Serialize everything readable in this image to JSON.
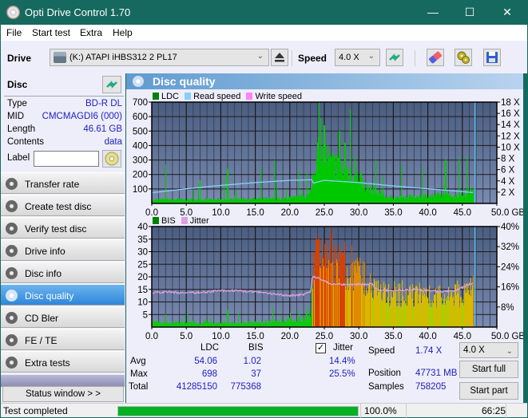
{
  "window": {
    "title": "Opti Drive Control 1.70",
    "controls": {
      "minimize": "—",
      "maximize": "☐",
      "close": "✕"
    }
  },
  "menu": [
    "File",
    "Start test",
    "Extra",
    "Help"
  ],
  "toolbar": {
    "drive_label": "Drive",
    "drive_value": "(K:)  ATAPI iHBS312  2 PL17",
    "speed_label": "Speed",
    "speed_value": "4.0 X",
    "icons": [
      "eject-icon",
      "refresh-icon",
      "erase-icon",
      "settings-icon",
      "save-icon"
    ]
  },
  "disc": {
    "heading": "Disc",
    "rows": [
      {
        "key": "Type",
        "value": "BD-R DL"
      },
      {
        "key": "MID",
        "value": "CMCMAGDI6 (000)"
      },
      {
        "key": "Length",
        "value": "46.61 GB"
      },
      {
        "key": "Contents",
        "value": "data"
      }
    ],
    "label_key": "Label",
    "label_value": ""
  },
  "nav": {
    "items": [
      {
        "label": "Transfer rate",
        "active": false
      },
      {
        "label": "Create test disc",
        "active": false
      },
      {
        "label": "Verify test disc",
        "active": false
      },
      {
        "label": "Drive info",
        "active": false
      },
      {
        "label": "Disc info",
        "active": false
      },
      {
        "label": "Disc quality",
        "active": true
      },
      {
        "label": "CD Bler",
        "active": false
      },
      {
        "label": "FE / TE",
        "active": false
      },
      {
        "label": "Extra tests",
        "active": false
      }
    ],
    "status_window_label": "Status window > >"
  },
  "main": {
    "title": "Disc quality"
  },
  "chart_data": [
    {
      "type": "bar",
      "title": "LDC / Read speed",
      "legend": [
        {
          "name": "LDC",
          "color": "#008000"
        },
        {
          "name": "Read speed",
          "color": "#87cefa"
        },
        {
          "name": "Write speed",
          "color": "#ff80ff"
        }
      ],
      "legend_position": "top-left",
      "xlabel": "GB",
      "xlim": [
        0,
        50
      ],
      "x_ticks": [
        "0.0",
        "5.0",
        "10.0",
        "15.0",
        "20.0",
        "25.0",
        "30.0",
        "35.0",
        "40.0",
        "45.0",
        "50.0 GB"
      ],
      "ylim": [
        0,
        700
      ],
      "y_ticks": [
        "100",
        "200",
        "300",
        "400",
        "500",
        "600",
        "700"
      ],
      "y2lim": [
        0,
        18
      ],
      "y2_ticks": [
        "2 X",
        "4 X",
        "6 X",
        "8 X",
        "10 X",
        "12 X",
        "14 X",
        "16 X",
        "18 X"
      ],
      "grid": true,
      "disc_end_gb": 46.61,
      "series": [
        {
          "name": "LDC",
          "color": "#00c800",
          "x": [
            0,
            2,
            4,
            6,
            8,
            10,
            12,
            14,
            16,
            18,
            20,
            21,
            22,
            23,
            23.5,
            24,
            24.5,
            25,
            25.5,
            26,
            27,
            28,
            29,
            30,
            31,
            32,
            33,
            34,
            36,
            38,
            40,
            42,
            44,
            45,
            46,
            46.5
          ],
          "values": [
            25,
            30,
            30,
            28,
            30,
            30,
            32,
            35,
            35,
            38,
            40,
            45,
            55,
            80,
            250,
            420,
            500,
            380,
            350,
            310,
            280,
            260,
            240,
            220,
            130,
            110,
            90,
            50,
            45,
            55,
            60,
            60,
            60,
            70,
            90,
            110
          ]
        },
        {
          "name": "LDC peaks",
          "x": [
            2,
            7,
            10.5,
            11,
            15.8,
            17.8,
            21.2,
            22.5,
            25,
            27.2,
            28,
            28.8,
            29.5,
            32.5,
            39.2,
            42.5,
            44.5,
            45.7
          ],
          "values": [
            270,
            160,
            165,
            240,
            250,
            300,
            230,
            220,
            540,
            500,
            420,
            650,
            330,
            300,
            240,
            300,
            320,
            320
          ]
        },
        {
          "name": "Read speed",
          "color": "#87cefa",
          "x": [
            0,
            5,
            10,
            15,
            20,
            23.2,
            23.4,
            25,
            30,
            35,
            40,
            45,
            46.61
          ],
          "values": [
            1.9,
            2.6,
            3.2,
            3.7,
            4.1,
            4.2,
            3.6,
            4.1,
            3.7,
            3.1,
            2.6,
            2.1,
            1.9
          ]
        }
      ]
    },
    {
      "type": "bar",
      "title": "BIS / Jitter",
      "legend": [
        {
          "name": "BIS",
          "color": "#008000"
        },
        {
          "name": "Jitter",
          "color": "#dda0dd"
        }
      ],
      "legend_position": "top-left",
      "xlabel": "GB",
      "xlim": [
        0,
        50
      ],
      "x_ticks": [
        "0.0",
        "5.0",
        "10.0",
        "15.0",
        "20.0",
        "25.0",
        "30.0",
        "35.0",
        "40.0",
        "45.0",
        "50.0 GB"
      ],
      "ylim": [
        0,
        40
      ],
      "y_ticks": [
        "5",
        "10",
        "15",
        "20",
        "25",
        "30",
        "35",
        "40"
      ],
      "y2lim": [
        0,
        40
      ],
      "y2_ticks": [
        "8%",
        "16%",
        "24%",
        "32%",
        "40%"
      ],
      "grid": true,
      "disc_end_gb": 46.61,
      "series": [
        {
          "name": "BIS",
          "x": [
            0,
            5,
            10,
            15,
            20,
            22,
            23,
            23.3,
            24,
            25,
            26,
            27,
            28,
            29,
            30,
            31,
            32,
            33,
            35,
            37,
            39,
            41,
            43,
            45,
            46,
            46.5
          ],
          "values": [
            2,
            2,
            2,
            2,
            3,
            4,
            5,
            25,
            30,
            28,
            30,
            27,
            25,
            24,
            23,
            22,
            20,
            15,
            14,
            14,
            15,
            13,
            14,
            14,
            18,
            22
          ]
        },
        {
          "name": "BIS peaks",
          "x": [
            2,
            11,
            17.5,
            22.5,
            24.2,
            25.1,
            26.1,
            27.0,
            27.6
          ],
          "values": [
            5,
            7,
            8,
            8,
            35,
            33,
            37,
            30,
            30
          ]
        },
        {
          "name": "Jitter",
          "color": "#dda0dd",
          "x": [
            0,
            2,
            5,
            8,
            10,
            12,
            15,
            18,
            20,
            22,
            23,
            23.3,
            24,
            25,
            26,
            28,
            30,
            32,
            32.6,
            35,
            38,
            40,
            42,
            44,
            46,
            46.5
          ],
          "values": [
            13.5,
            14,
            13.5,
            14,
            14.5,
            14.5,
            14,
            13,
            12.5,
            13,
            14,
            20,
            19.5,
            18.5,
            17,
            17,
            17,
            17,
            15,
            14.5,
            15,
            14.5,
            14,
            14.5,
            17,
            17.5
          ]
        }
      ]
    }
  ],
  "stats": {
    "headers": [
      "LDC",
      "BIS"
    ],
    "rows": [
      {
        "label": "Avg",
        "ldc": "54.06",
        "bis": "1.02",
        "jitter": "14.4%"
      },
      {
        "label": "Max",
        "ldc": "698",
        "bis": "37",
        "jitter": "25.5%"
      },
      {
        "label": "Total",
        "ldc": "41285150",
        "bis": "775368"
      }
    ],
    "jitter_label": "Jitter",
    "jitter_checked": true,
    "speed_label": "Speed",
    "speed_value": "1.74 X",
    "position_label": "Position",
    "position_value": "47731 MB",
    "samples_label": "Samples",
    "samples_value": "758205",
    "speed_select": "4.0 X",
    "start_full": "Start full",
    "start_part": "Start part"
  },
  "statusbar": {
    "text": "Test completed",
    "progress_percent": 100,
    "progress_label": "100.0%",
    "time": "66:25"
  }
}
